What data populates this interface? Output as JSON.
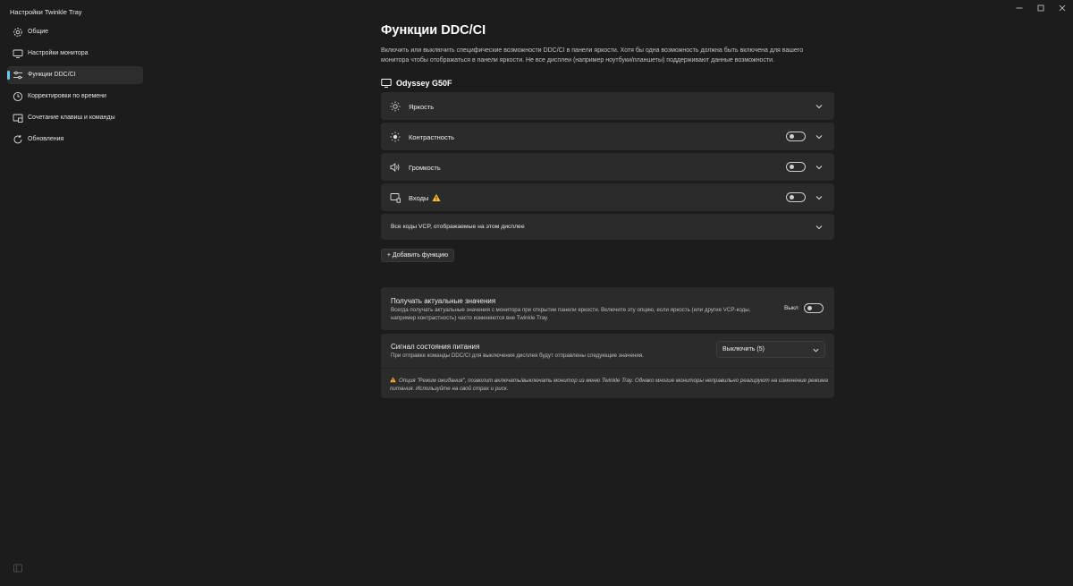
{
  "window": {
    "title": "Настройки Twinkle Tray"
  },
  "sidebar": {
    "items": [
      {
        "label": "Общие",
        "icon": "gear-icon"
      },
      {
        "label": "Настройки монитора",
        "icon": "monitor-icon"
      },
      {
        "label": "Функции DDC/CI",
        "icon": "sliders-icon",
        "active": true
      },
      {
        "label": "Корректировки по времени",
        "icon": "clock-icon"
      },
      {
        "label": "Сочетание клавиш и команды",
        "icon": "keyboard-icon"
      },
      {
        "label": "Обновления",
        "icon": "refresh-icon"
      }
    ]
  },
  "page": {
    "title": "Функции DDC/CI",
    "description": "Включить или выключить специфические возможности DDC/CI в панели яркости. Хотя бы одна возможность должна быть включена для вашего монитора чтобы отображаться в панели яркости. Не все дисплеи (например ноутбуки/планшеты) поддерживают данные возможности."
  },
  "monitor": {
    "name": "Odyssey G50F",
    "features": [
      {
        "label": "Яркость",
        "icon": "sun-icon",
        "has_toggle": false
      },
      {
        "label": "Контрастность",
        "icon": "contrast-icon",
        "has_toggle": true,
        "enabled": false
      },
      {
        "label": "Громкость",
        "icon": "speaker-icon",
        "has_toggle": true,
        "enabled": false
      },
      {
        "label": "Входы",
        "icon": "input-icon",
        "has_toggle": true,
        "enabled": false,
        "warning": true
      }
    ],
    "vcp_label": "Все коды VCP, отображаемые на этом дисплее"
  },
  "add_feature_label": "+ Добавить функцию",
  "settings": {
    "refresh": {
      "title": "Получать актуальные значения",
      "description": "Всегда получать актуальные значения с монитора при открытии панели яркости. Включите эту опцию, если яркость (или другие VCP-коды, например контрастность) часто изменяются вне Twinkle Tray.",
      "toggle_label": "Выкл",
      "enabled": false
    },
    "power": {
      "title": "Сигнал состояния питания",
      "description": "При отправке команды DDC/CI для выключения дисплея будут отправлены следующие значения.",
      "selected": "Выключить (5)",
      "warning": "Опция \"Режим ожидания\", позволит включать/выключать монитор из меню Twinkle Tray. Однако многие мониторы неправильно реагируют на изменение режима питания. Используйте на свой страх и риск."
    }
  },
  "colors": {
    "accent": "#60cdff",
    "warning": "#fcbc2e",
    "card": "#2b2b2b",
    "background": "#1c1c1c"
  }
}
